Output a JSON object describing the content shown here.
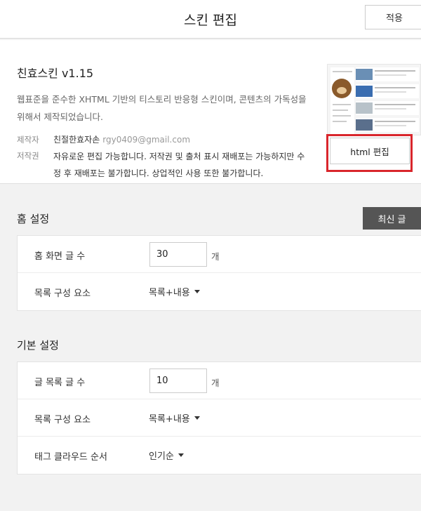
{
  "header": {
    "title": "스킨 편집",
    "apply_label": "적용"
  },
  "skin": {
    "name": "친효스킨 v1.15",
    "description": "웹표준을 준수한 XHTML 기반의 티스토리 반응형 스킨이며, 콘텐츠의 가독성을 위해서 제작되었습니다.",
    "maker_label": "제작자",
    "maker_value": "친절한효자손",
    "maker_email": "rgy0409@gmail.com",
    "copyright_label": "저작권",
    "copyright_value": "자유로운 편집 가능합니다. 저작권 및 출처 표시 재배포는 가능하지만 수정 후 재배포는 불가합니다. 상업적인 사용 또한 불가합니다.",
    "html_edit_label": "html 편집"
  },
  "home_settings": {
    "title": "홈 설정",
    "latest_label": "최신 글",
    "post_count_label": "홈 화면 글 수",
    "post_count_value": "30",
    "post_count_unit": "개",
    "list_component_label": "목록 구성 요소",
    "list_component_value": "목록+내용"
  },
  "basic_settings": {
    "title": "기본 설정",
    "list_count_label": "글 목록 글 수",
    "list_count_value": "10",
    "list_count_unit": "개",
    "list_component_label": "목록 구성 요소",
    "list_component_value": "목록+내용",
    "tag_order_label": "태그 클라우드 순서",
    "tag_order_value": "인기순"
  },
  "colors": {
    "highlight": "#d9262c",
    "latest_button_bg": "#555555"
  }
}
